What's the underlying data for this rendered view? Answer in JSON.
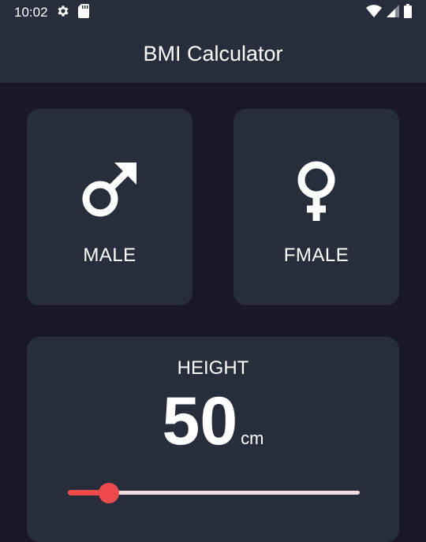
{
  "status_bar": {
    "time": "10:02",
    "icons_left": [
      "gear-icon",
      "sd-card-icon"
    ],
    "icons_right": [
      "wifi-icon",
      "cell-signal-icon",
      "battery-icon"
    ]
  },
  "app_bar": {
    "title": "BMI Calculator"
  },
  "gender": {
    "male": {
      "label": "MALE",
      "icon": "male-symbol-icon"
    },
    "female": {
      "label": "FMALE",
      "icon": "female-symbol-icon"
    }
  },
  "height": {
    "title": "HEIGHT",
    "value": "50",
    "unit": "cm",
    "slider_fraction": 0.14
  },
  "colors": {
    "background": "#1a1729",
    "card": "#272d3b",
    "accent": "#ef4b4c",
    "track": "#f3dbe3"
  }
}
